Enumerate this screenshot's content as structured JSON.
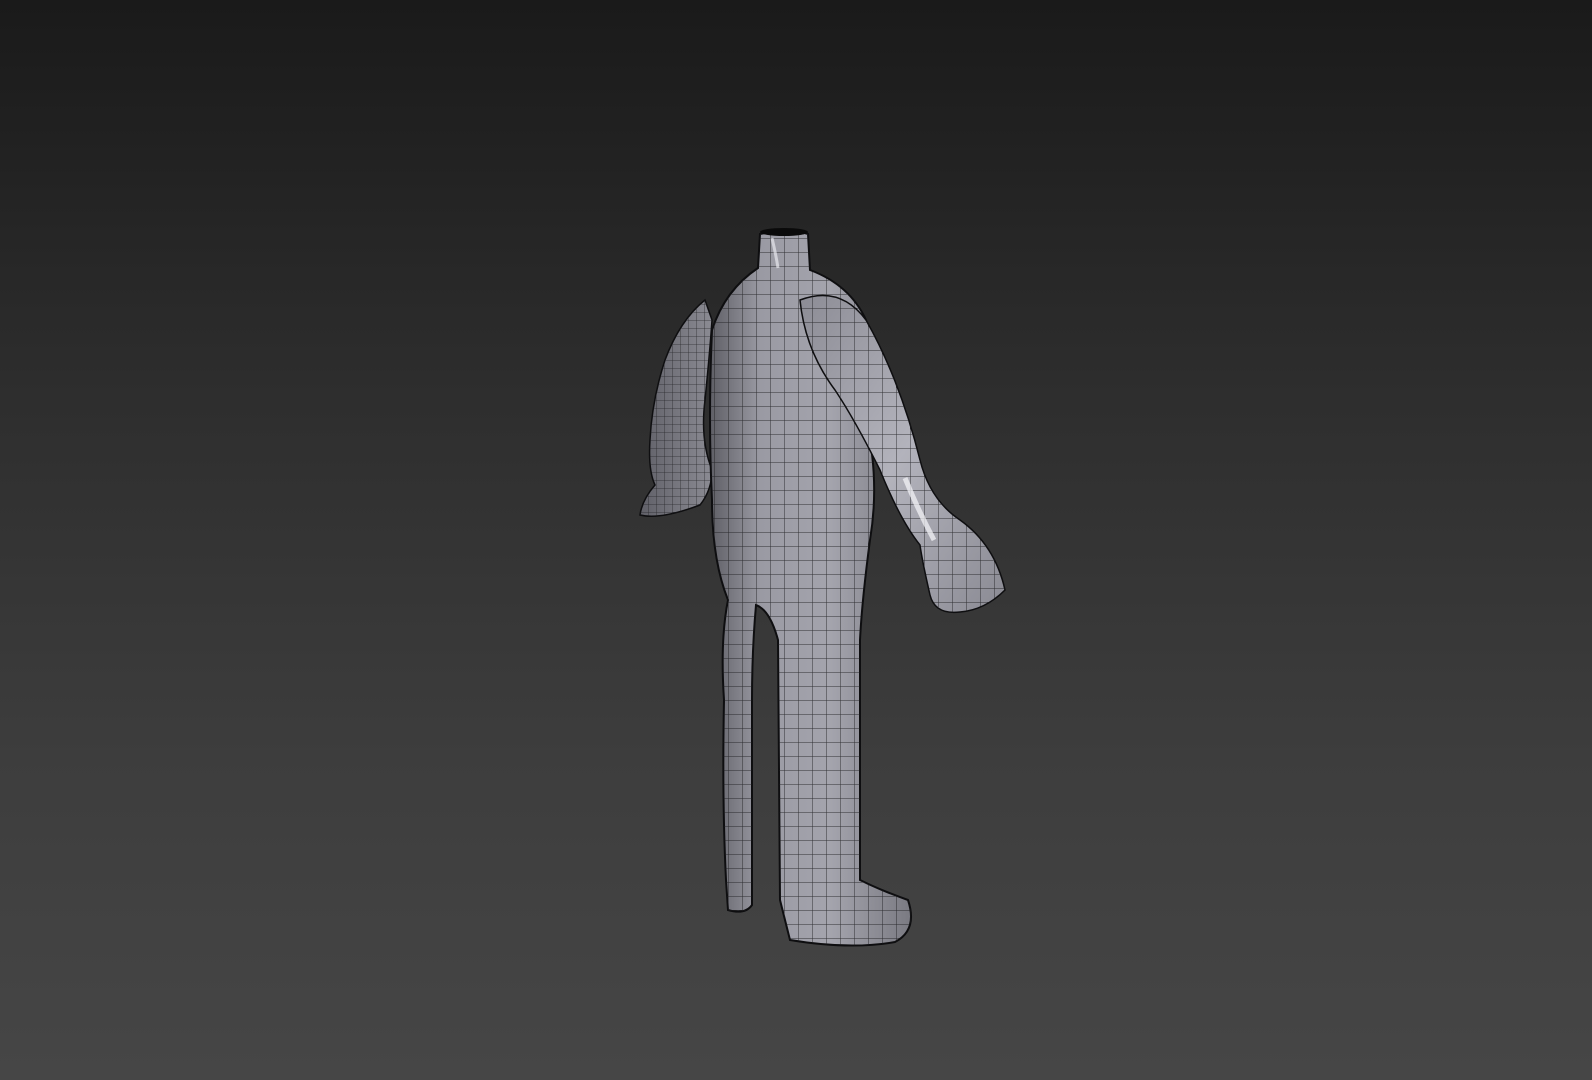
{
  "viewport": {
    "background_top": "#1a1a1a",
    "background_bottom": "#464646",
    "mesh_color": "#9a9aa2",
    "wire_color": "#1c1c1e",
    "content": "wireframe-shaded-headless-character-mesh"
  }
}
